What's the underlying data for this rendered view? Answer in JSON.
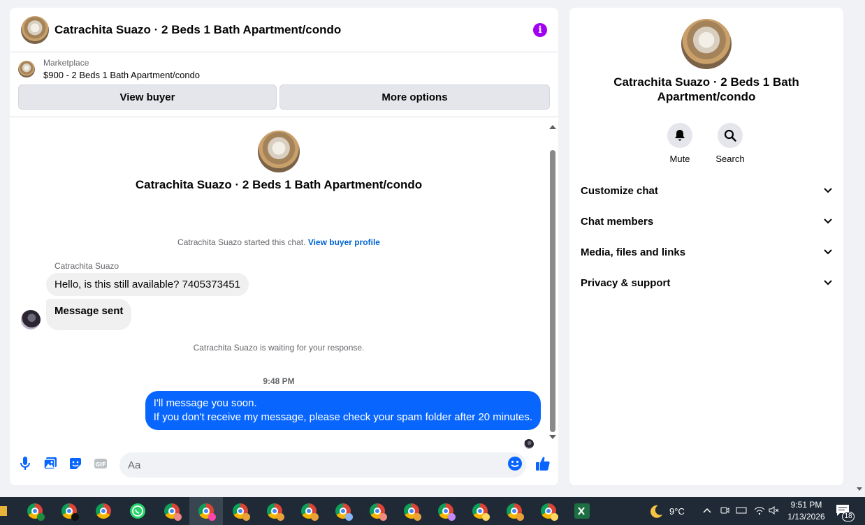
{
  "chat": {
    "header_title": "Catrachita Suazo · 2 Beds 1 Bath Apartment/condo",
    "marketplace_label": "Marketplace",
    "listing": "$900 - 2 Beds 1 Bath Apartment/condo",
    "view_buyer_label": "View buyer",
    "more_options_label": "More options",
    "convo_title": "Catrachita Suazo · 2 Beds 1 Bath Apartment/condo",
    "started_text": "Catrachita Suazo started this chat.",
    "view_buyer_profile_link": "View buyer profile",
    "sender_name": "Catrachita Suazo",
    "message_1": "Hello, is this still available? 7405373451",
    "message_2": "Message sent",
    "waiting_text": "Catrachita Suazo is waiting for your response.",
    "timestamp": "9:48 PM",
    "reply_line_1": "I'll message you soon.",
    "reply_line_2": "If you don't receive my message, please check your spam folder after 20 minutes.",
    "composer_placeholder": "Aa",
    "composer_icons": [
      "microphone-icon",
      "photo-icon",
      "sticker-icon",
      "gif-icon",
      "emoji-icon",
      "thumbs-up-icon"
    ],
    "accent_color": "#0866ff",
    "info_color": "#a200f2"
  },
  "info_panel": {
    "title": "Catrachita Suazo · 2 Beds 1 Bath Apartment/condo",
    "mute_label": "Mute",
    "search_label": "Search",
    "sections": [
      "Customize chat",
      "Chat members",
      "Media, files and links",
      "Privacy & support"
    ]
  },
  "taskbar": {
    "weather": "9°C",
    "time": "9:51 PM",
    "date": "1/13/2026",
    "notification_count": "18",
    "gif_label": "GIF"
  }
}
